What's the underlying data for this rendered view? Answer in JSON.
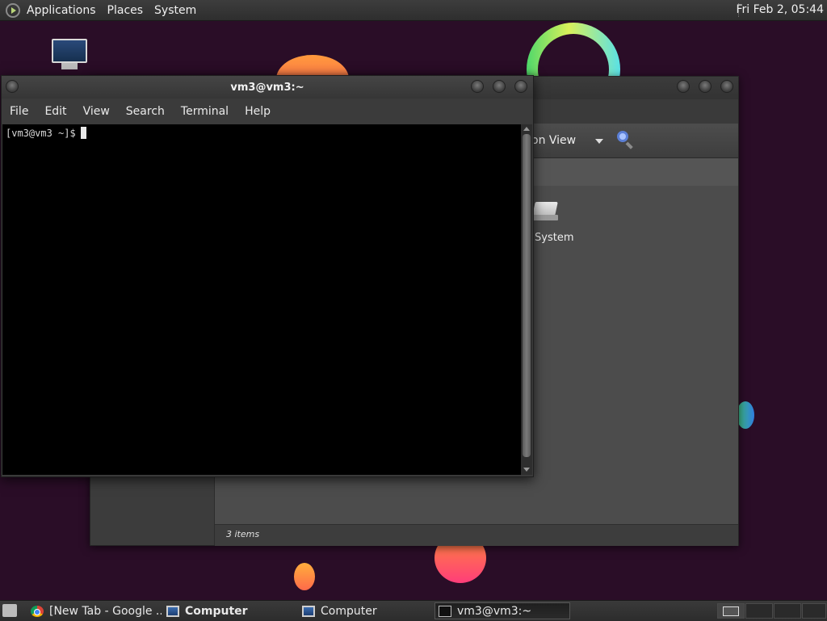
{
  "top_panel": {
    "menus": [
      "Applications",
      "Places",
      "System"
    ],
    "clock": "Fri Feb  2, 05:44"
  },
  "file_manager": {
    "view_label": "on View",
    "drive_label": "System",
    "status": "3 items"
  },
  "terminal": {
    "title": "vm3@vm3:~",
    "menus": [
      "File",
      "Edit",
      "View",
      "Search",
      "Terminal",
      "Help"
    ],
    "prompt": "[vm3@vm3 ~]$"
  },
  "taskbar": {
    "tasks": [
      {
        "label": "[New Tab - Google ...",
        "icon": "chrome-icon",
        "active": false
      },
      {
        "label": "Computer",
        "icon": "computer-icon",
        "active": false,
        "bold": true
      },
      {
        "label": "Computer",
        "icon": "computer-icon",
        "active": false
      },
      {
        "label": "vm3@vm3:~",
        "icon": "terminal-icon",
        "active": true
      }
    ]
  }
}
